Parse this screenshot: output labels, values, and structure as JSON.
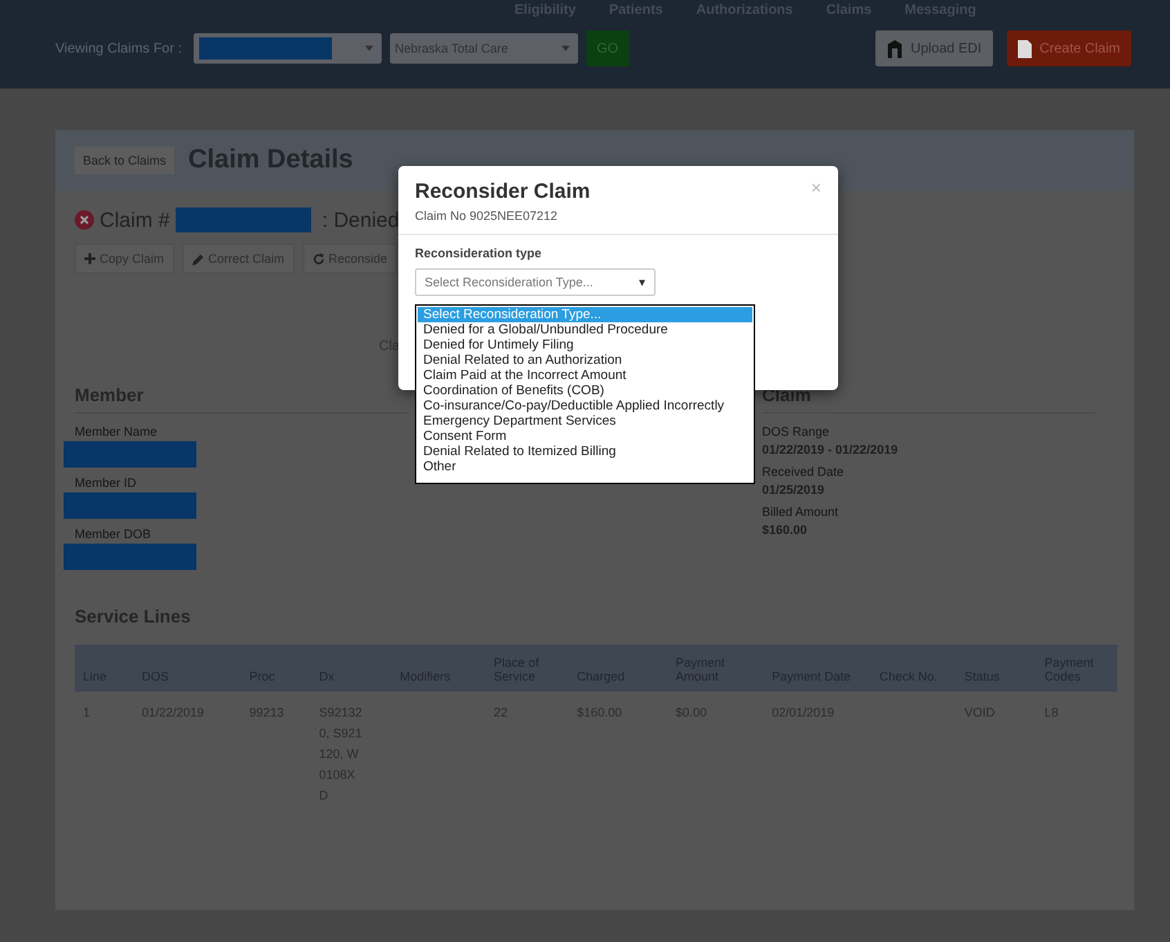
{
  "nav": {
    "links": [
      "Eligibility",
      "Patients",
      "Authorizations",
      "Claims",
      "Messaging"
    ]
  },
  "toolbar": {
    "label": "Viewing Claims For :",
    "payer_select": "Nebraska Total Care",
    "go": "GO",
    "upload": "Upload EDI",
    "create": "Create Claim"
  },
  "page": {
    "back": "Back to Claims",
    "title": "Claim Details",
    "claim_prefix": "Claim #",
    "status": ": Denied",
    "actions": [
      "Copy Claim",
      "Correct Claim",
      "Reconside"
    ],
    "covered_text": "Cla"
  },
  "member": {
    "heading": "Member",
    "fields": [
      "Member Name",
      "Member ID",
      "Member DOB"
    ]
  },
  "claim": {
    "heading": "Claim",
    "fields": [
      {
        "label": "DOS Range",
        "value": "01/22/2019 - 01/22/2019"
      },
      {
        "label": "Received Date",
        "value": "01/25/2019"
      },
      {
        "label": "Billed Amount",
        "value": "$160.00"
      }
    ]
  },
  "service_lines": {
    "heading": "Service Lines",
    "columns": [
      "Line",
      "DOS",
      "Proc",
      "Dx",
      "Modifiers",
      "Place of Service",
      "Charged",
      "Payment Amount",
      "Payment Date",
      "Check No.",
      "Status",
      "Payment Codes"
    ],
    "rows": [
      [
        "1",
        "01/22/2019",
        "99213",
        "S921320, S921120, W0108XD",
        "",
        "22",
        "$160.00",
        "$0.00",
        "02/01/2019",
        "",
        "VOID",
        "L8"
      ]
    ]
  },
  "modal": {
    "title": "Reconsider Claim",
    "subtitle": "Claim No 9025NEE07212",
    "close": "×",
    "field_label": "Reconsideration type",
    "placeholder": "Select Reconsideration Type...",
    "caret": "▾",
    "options": [
      {
        "label": "Select Reconsideration Type...",
        "selected": true
      },
      {
        "label": "Denied for a Global/Unbundled Procedure",
        "selected": false
      },
      {
        "label": "Denied for Untimely Filing",
        "selected": false
      },
      {
        "label": "Denial Related to an Authorization",
        "selected": false
      },
      {
        "label": "Claim Paid at the Incorrect Amount",
        "selected": false
      },
      {
        "label": "Coordination of Benefits (COB)",
        "selected": false
      },
      {
        "label": "Co-insurance/Co-pay/Deductible Applied Incorrectly",
        "selected": false
      },
      {
        "label": "Emergency Department Services",
        "selected": false
      },
      {
        "label": "Consent Form",
        "selected": false
      },
      {
        "label": "Denial Related to Itemized Billing",
        "selected": false
      },
      {
        "label": "Other",
        "selected": false
      }
    ]
  }
}
